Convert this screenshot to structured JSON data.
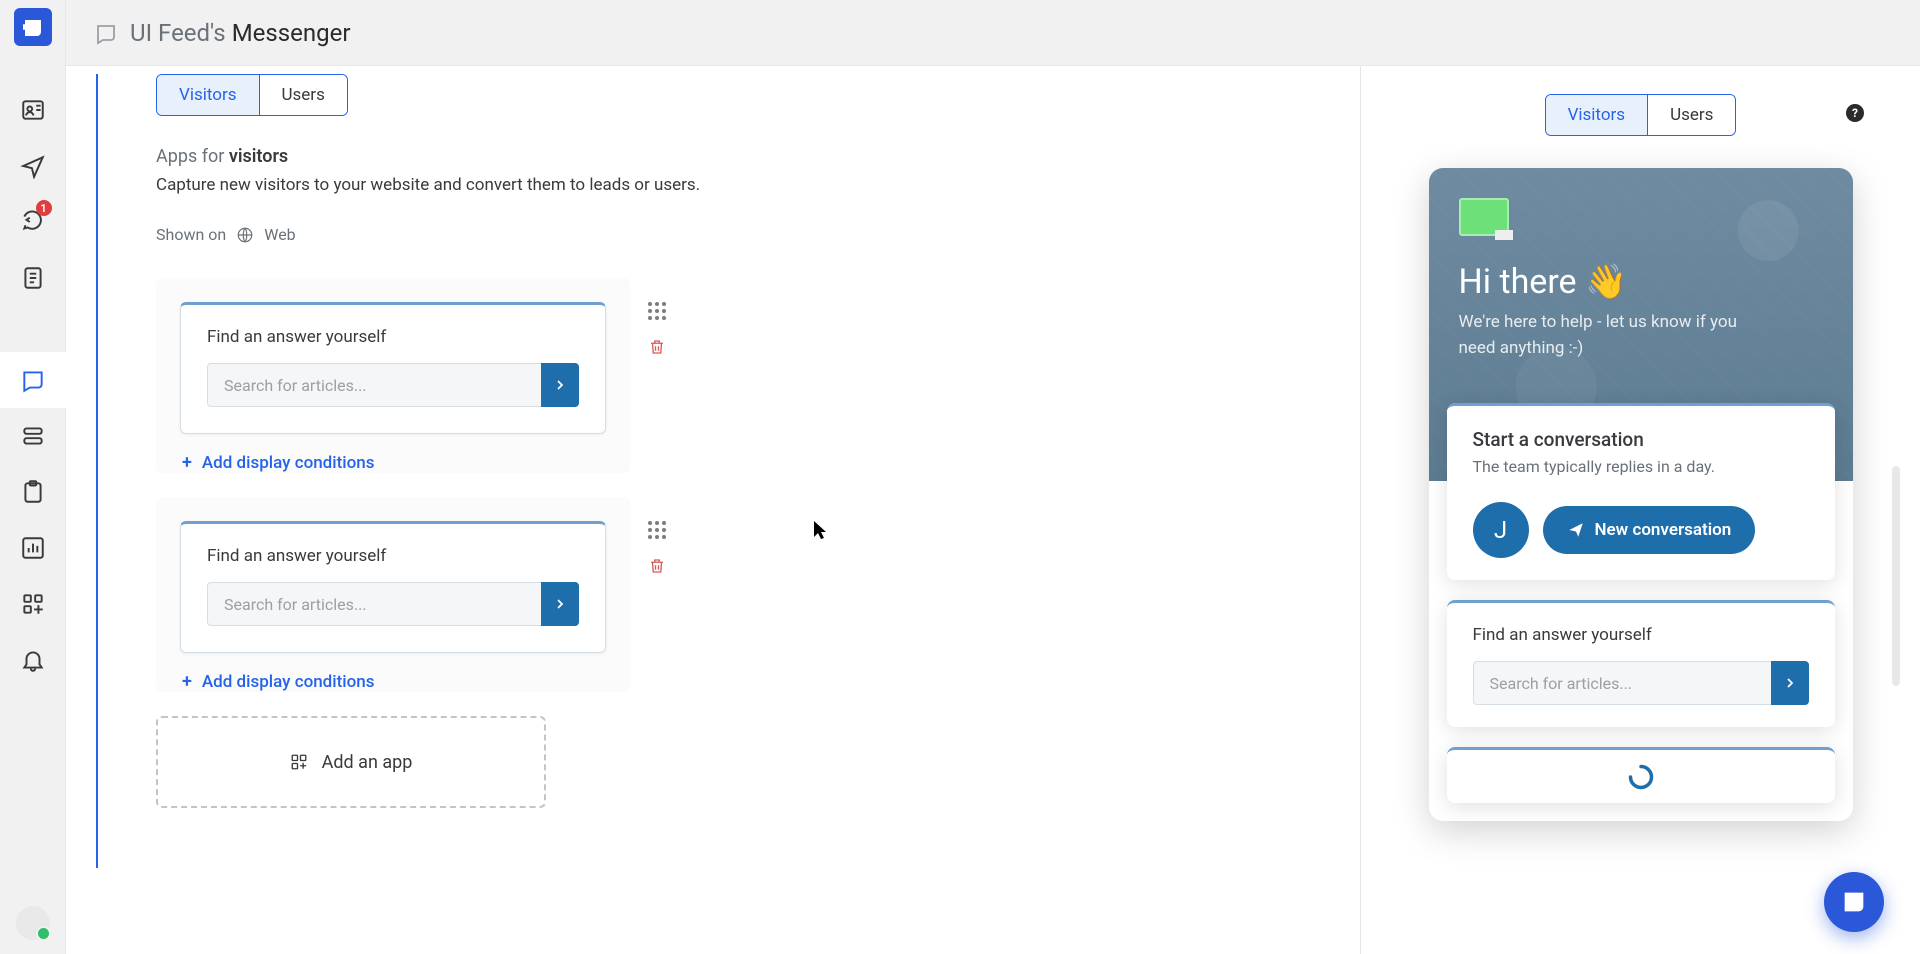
{
  "rail": {
    "badge": "1"
  },
  "header": {
    "title_prefix": "UI Feed's",
    "title_main": "Messenger"
  },
  "tabs": {
    "visitors": "Visitors",
    "users": "Users"
  },
  "apps_for_prefix": "Apps for ",
  "apps_for_strong": "visitors",
  "apps_for_sub": "Capture new visitors to your website and convert them to leads or users.",
  "shown_on_label": "Shown on",
  "shown_on_value": "Web",
  "card": {
    "title": "Find an answer yourself",
    "placeholder": "Search for articles..."
  },
  "add_conditions": "Add display conditions",
  "add_app": "Add an app",
  "preview": {
    "greeting": "Hi there 👋",
    "subtitle": "We're here to help - let us know if you need anything :-)",
    "start_title": "Start a conversation",
    "start_sub": "The team typically replies in a day.",
    "avatar_letter": "J",
    "new_conv": "New conversation"
  }
}
